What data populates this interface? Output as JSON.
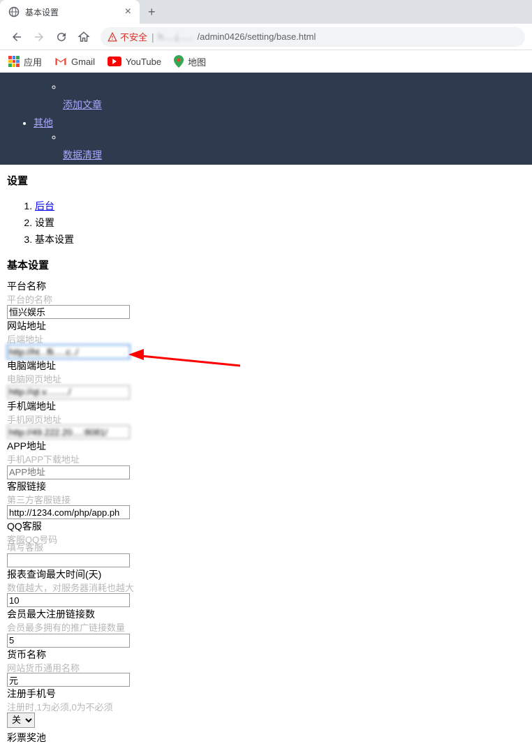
{
  "browser": {
    "tab_title": "基本设置",
    "insecure_label": "不安全",
    "url_hidden": "h.....j......",
    "url_path": "/admin0426/setting/base.html"
  },
  "bookmarks": {
    "apps": "应用",
    "gmail": "Gmail",
    "youtube": "YouTube",
    "maps": "地图"
  },
  "dark_nav": {
    "link_add_article": "添加文章",
    "link_other": "其他",
    "link_data_clean": "数据清理"
  },
  "page": {
    "title": "设置",
    "crumbs": {
      "c1": "后台",
      "c2": "设置",
      "c3": "基本设置"
    },
    "section": "基本设置"
  },
  "form": {
    "platform_name": {
      "label": "平台名称",
      "hint": "平台的名称",
      "value": "恒兴娱乐"
    },
    "site_url": {
      "label": "网站地址",
      "hint": "后端地址",
      "value": "http://ht...fli.....c../"
    },
    "pc_url": {
      "label": "电脑端地址",
      "hint": "电脑网页地址",
      "value": "http://qt.v........./"
    },
    "mobile_url": {
      "label": "手机端地址",
      "hint": "手机网页地址",
      "value": "http://49.222.20....:8081/"
    },
    "app_url": {
      "label": "APP地址",
      "hint": "手机APP下载地址",
      "placeholder": "APP地址",
      "value": ""
    },
    "cs_link": {
      "label": "客服链接",
      "hint": "第三方客服链接",
      "value": "http://1234.com/php/app.ph"
    },
    "qq_cs": {
      "label": "QQ客服",
      "hint": "客服QQ号码",
      "hint2": "填写客服",
      "value": ""
    },
    "report_days": {
      "label": "报表查询最大时间(天)",
      "hint": "数值越大，对服务器消耗也越大",
      "value": "10"
    },
    "max_reg_links": {
      "label": "会员最大注册链接数",
      "hint": "会员最多拥有的推广链接数量",
      "value": "5"
    },
    "currency": {
      "label": "货币名称",
      "hint": "网站货币通用名称",
      "value": "元"
    },
    "reg_phone": {
      "label": "注册手机号",
      "hint": "注册时,1为必须,0为不必须",
      "value": "关"
    },
    "lottery_pool": {
      "label": "彩票奖池"
    }
  }
}
